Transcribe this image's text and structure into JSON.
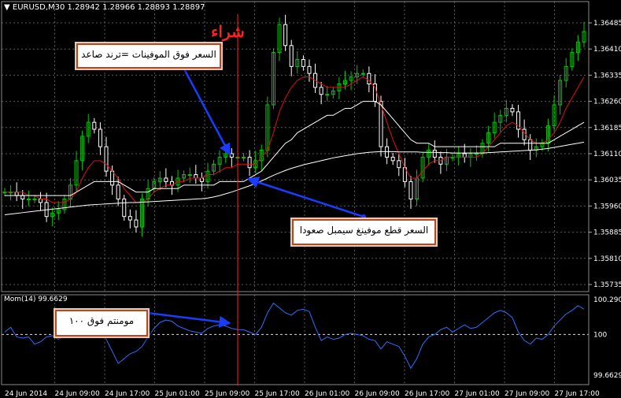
{
  "header": {
    "dropdown_icon": "triangle-down-icon",
    "symbol": "EURUSD,M30",
    "ohlc": "1.28942 1.28966 1.28893 1.28897"
  },
  "buy_label": "شراء",
  "annotations": {
    "trend": "السعر فوق الموفينات =ترند صاعد",
    "cross": "السعر قطع موفينغ سيمبل صعودا",
    "momentum": "مومنتم فوق ١٠٠"
  },
  "colors": {
    "background": "#000000",
    "bull_candle": "#00c800",
    "bear_candle": "#ffffff",
    "ma_fast": "#e01010",
    "ma_slow_1": "#ffffff",
    "ma_slow_2": "#ffffff",
    "momentum_line": "#2f6fff",
    "grid": "#5a5a5a",
    "signal_line": "#ff2020",
    "arrow": "#1a3cff"
  },
  "chart_data": [
    {
      "type": "line",
      "title": "EURUSD,M30",
      "y_axis_ticks": [
        "1.36485",
        "1.36410",
        "1.36335",
        "1.36260",
        "1.36185",
        "1.36110",
        "1.36035",
        "1.35960",
        "1.35885",
        "1.35810",
        "1.35735"
      ],
      "ylim": [
        1.35735,
        1.36485
      ],
      "x_axis_ticks": [
        "24 Jun 2014",
        "24 Jun 09:00",
        "24 Jun 17:00",
        "25 Jun 01:00",
        "25 Jun 09:00",
        "25 Jun 17:00",
        "26 Jun 01:00",
        "26 Jun 09:00",
        "26 Jun 17:00",
        "27 Jun 01:00",
        "27 Jun 09:00",
        "27 Jun 17:00"
      ],
      "grid": true,
      "price_close": [
        1.36,
        1.36,
        1.3599,
        1.3598,
        1.3598,
        1.3598,
        1.3597,
        1.3593,
        1.3594,
        1.3595,
        1.3598,
        1.3602,
        1.3609,
        1.3616,
        1.362,
        1.3618,
        1.3613,
        1.3606,
        1.3602,
        1.3598,
        1.3593,
        1.3592,
        1.359,
        1.3598,
        1.3601,
        1.3603,
        1.3604,
        1.3603,
        1.3602,
        1.3604,
        1.3605,
        1.3605,
        1.3604,
        1.3603,
        1.3606,
        1.3608,
        1.361,
        1.3611,
        1.361,
        1.361,
        1.361,
        1.3607,
        1.3609,
        1.3612,
        1.3625,
        1.364,
        1.3648,
        1.3642,
        1.3636,
        1.3638,
        1.3636,
        1.3634,
        1.363,
        1.3628,
        1.3628,
        1.3629,
        1.3631,
        1.3632,
        1.3633,
        1.3634,
        1.3634,
        1.3631,
        1.3626,
        1.3613,
        1.361,
        1.3609,
        1.3607,
        1.3603,
        1.3598,
        1.3604,
        1.361,
        1.3612,
        1.361,
        1.3608,
        1.361,
        1.361,
        1.3611,
        1.361,
        1.3611,
        1.3611,
        1.3614,
        1.3617,
        1.362,
        1.3622,
        1.3624,
        1.3623,
        1.3618,
        1.3615,
        1.3612,
        1.3613,
        1.3614,
        1.3619,
        1.3625,
        1.3632,
        1.3636,
        1.364,
        1.3643,
        1.3646
      ],
      "series": [
        {
          "values": [
            1.36,
            1.36,
            1.36,
            1.36,
            1.3599,
            1.3599,
            1.3598,
            1.3598,
            1.3597,
            1.3597,
            1.3597,
            1.3598,
            1.36,
            1.3604,
            1.3607,
            1.3609,
            1.3609,
            1.3608,
            1.3606,
            1.3604,
            1.3601,
            1.3599,
            1.3597,
            1.3597,
            1.3598,
            1.36,
            1.3601,
            1.3602,
            1.3602,
            1.3603,
            1.3603,
            1.3604,
            1.3604,
            1.3604,
            1.3605,
            1.3605,
            1.3606,
            1.3607,
            1.3607,
            1.3608,
            1.3608,
            1.3608,
            1.3608,
            1.361,
            1.3612,
            1.3617,
            1.3623,
            1.3627,
            1.363,
            1.3632,
            1.3633,
            1.3633,
            1.3632,
            1.3631,
            1.363,
            1.363,
            1.363,
            1.363,
            1.3631,
            1.3632,
            1.3633,
            1.3632,
            1.363,
            1.3625,
            1.362,
            1.3615,
            1.3611,
            1.3607,
            1.3604,
            1.3604,
            1.3606,
            1.3608,
            1.3609,
            1.3609,
            1.361,
            1.361,
            1.361,
            1.361,
            1.361,
            1.361,
            1.3611,
            1.3613,
            1.3615,
            1.3617,
            1.3619,
            1.362,
            1.3619,
            1.3617,
            1.3615,
            1.3614,
            1.3614,
            1.3615,
            1.3617,
            1.362,
            1.3624,
            1.3627,
            1.363,
            1.3633
          ]
        },
        {
          "values": [
            1.3599,
            1.3599,
            1.3599,
            1.3599,
            1.3599,
            1.3599,
            1.3599,
            1.3599,
            1.3599,
            1.3599,
            1.3599,
            1.3599,
            1.36,
            1.3601,
            1.3602,
            1.3603,
            1.3603,
            1.3603,
            1.3603,
            1.3603,
            1.3602,
            1.3601,
            1.36,
            1.36,
            1.36,
            1.3601,
            1.3601,
            1.3601,
            1.3601,
            1.3601,
            1.3602,
            1.3602,
            1.3602,
            1.3602,
            1.3602,
            1.3602,
            1.3603,
            1.3603,
            1.3603,
            1.3603,
            1.3603,
            1.3604,
            1.3605,
            1.3606,
            1.3608,
            1.361,
            1.3612,
            1.3614,
            1.3615,
            1.3617,
            1.3618,
            1.3619,
            1.362,
            1.3621,
            1.3622,
            1.3622,
            1.3623,
            1.3624,
            1.3624,
            1.3625,
            1.3626,
            1.3626,
            1.3626,
            1.3625,
            1.3623,
            1.3621,
            1.3619,
            1.3617,
            1.3615,
            1.3614,
            1.3614,
            1.3614,
            1.3613,
            1.3613,
            1.3613,
            1.3613,
            1.3613,
            1.3613,
            1.3613,
            1.3613,
            1.3613,
            1.3613,
            1.3613,
            1.3614,
            1.3614,
            1.3614,
            1.3614,
            1.3614,
            1.3614,
            1.3614,
            1.3614,
            1.3614,
            1.3615,
            1.3616,
            1.3617,
            1.3618,
            1.3619,
            1.362
          ]
        },
        {
          "values": [
            1.35935,
            1.35937,
            1.35939,
            1.35941,
            1.35943,
            1.35945,
            1.35947,
            1.35949,
            1.35951,
            1.35953,
            1.35955,
            1.35957,
            1.35959,
            1.35961,
            1.35963,
            1.35964,
            1.35965,
            1.35966,
            1.35967,
            1.35968,
            1.35969,
            1.3597,
            1.3597,
            1.35971,
            1.35972,
            1.35973,
            1.35974,
            1.35975,
            1.35976,
            1.35977,
            1.35978,
            1.35979,
            1.3598,
            1.35981,
            1.35983,
            1.35986,
            1.3599,
            1.35995,
            1.36,
            1.36006,
            1.36012,
            1.36018,
            1.36025,
            1.36032,
            1.3604,
            1.36048,
            1.36055,
            1.36062,
            1.36068,
            1.36073,
            1.36078,
            1.36082,
            1.36086,
            1.3609,
            1.36094,
            1.36098,
            1.36101,
            1.36104,
            1.36107,
            1.3611,
            1.36112,
            1.36114,
            1.36115,
            1.36116,
            1.36116,
            1.36116,
            1.36115,
            1.36115,
            1.36115,
            1.36115,
            1.36114,
            1.36114,
            1.36114,
            1.36113,
            1.36113,
            1.36112,
            1.36112,
            1.36112,
            1.36112,
            1.36112,
            1.36112,
            1.36113,
            1.36114,
            1.36115,
            1.36116,
            1.36117,
            1.36118,
            1.36119,
            1.3612,
            1.36121,
            1.36123,
            1.36125,
            1.36128,
            1.36131,
            1.36134,
            1.36137,
            1.3614,
            1.36143
          ]
        }
      ]
    },
    {
      "type": "line",
      "title": "Mom(14) 99.6629",
      "y_axis_ticks": [
        "100.2902",
        "100",
        "99.6629"
      ],
      "ylim": [
        99.6629,
        100.2902
      ],
      "reference_line": 100,
      "series": [
        {
          "values": [
            100.02,
            100.06,
            99.98,
            99.97,
            99.98,
            99.92,
            99.94,
            99.98,
            99.99,
            99.96,
            100.0,
            100.08,
            100.12,
            100.13,
            100.2,
            100.16,
            100.08,
            99.96,
            99.86,
            99.76,
            99.8,
            99.84,
            99.86,
            99.9,
            99.98,
            100.05,
            100.1,
            100.12,
            100.11,
            100.07,
            100.05,
            100.03,
            100.02,
            100.01,
            100.05,
            100.07,
            100.08,
            100.07,
            100.05,
            100.04,
            100.04,
            100.02,
            100.0,
            100.06,
            100.18,
            100.26,
            100.22,
            100.18,
            100.16,
            100.2,
            100.21,
            100.19,
            100.06,
            99.95,
            99.98,
            99.96,
            99.97,
            100.0,
            100.01,
            100.0,
            99.99,
            99.96,
            99.95,
            99.88,
            99.94,
            99.92,
            99.9,
            99.82,
            99.72,
            99.8,
            99.92,
            99.98,
            100.0,
            100.04,
            100.06,
            100.02,
            100.05,
            100.08,
            100.05,
            100.06,
            100.1,
            100.14,
            100.18,
            100.2,
            100.18,
            100.14,
            100.02,
            99.95,
            99.92,
            99.97,
            99.96,
            100.0,
            100.07,
            100.12,
            100.17,
            100.2,
            100.24,
            100.21
          ]
        }
      ]
    }
  ]
}
